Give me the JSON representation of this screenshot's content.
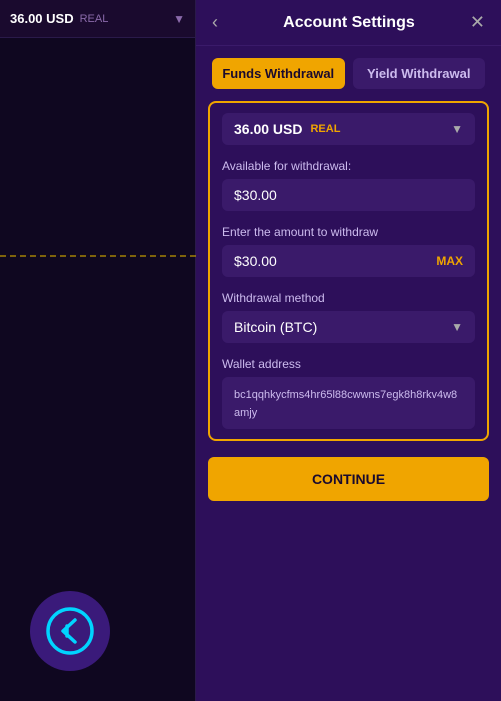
{
  "left_panel": {
    "account_label": "36.00 USD",
    "account_badge": "REAL",
    "account_arrow": "▼"
  },
  "modal": {
    "back_icon": "‹",
    "title": "Account Settings",
    "close_icon": "✕",
    "tabs": [
      {
        "id": "funds",
        "label": "Funds Withdrawal",
        "active": true
      },
      {
        "id": "yield",
        "label": "Yield Withdrawal",
        "active": false
      }
    ],
    "account_selector": {
      "value": "36.00 USD",
      "badge": "REAL",
      "arrow": "▼"
    },
    "available_label": "Available for withdrawal:",
    "available_value": "$30.00",
    "amount_label": "Enter the amount to withdraw",
    "amount_value": "$30.00",
    "max_label": "MAX",
    "method_label": "Withdrawal method",
    "method_value": "Bitcoin (BTC)",
    "method_arrow": "▼",
    "wallet_label": "Wallet address",
    "wallet_value": "bc1qqhkycfms4hr65l88cwwns7egk8h8rkv4w8amjy",
    "continue_label": "CONTINUE"
  },
  "logo": {
    "symbol": "ʗ"
  }
}
